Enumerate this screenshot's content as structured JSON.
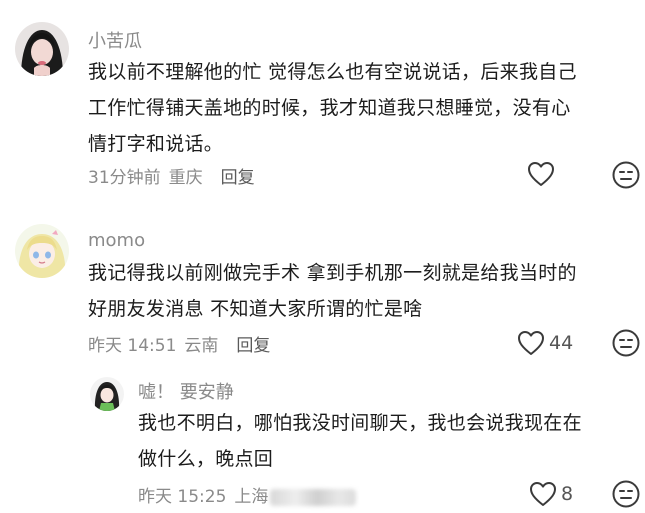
{
  "comments": [
    {
      "username": "小苦瓜",
      "lines": [
        "我以前不理解他的忙 觉得怎么也有空说说话，后来我自己",
        "工作忙得铺天盖地的时候，我才知道我只想睡觉，没有心",
        "情打字和说话。"
      ],
      "time": "31分钟前",
      "location": "重庆",
      "reply_label": "回复",
      "like_count": ""
    },
    {
      "username": "momo",
      "lines": [
        "我记得我以前刚做完手术 拿到手机那一刻就是给我当时的",
        "好朋友发消息 不知道大家所谓的忙是啥"
      ],
      "time": "昨天 14:51",
      "location": "云南",
      "reply_label": "回复",
      "like_count": "44"
    },
    {
      "username": "嘘！ 要安静",
      "lines": [
        "我也不明白，哪怕我没时间聊天，我也会说我现在在",
        "做什么，晚点回"
      ],
      "time": "昨天 15:25",
      "location": "上海",
      "like_count": "8"
    }
  ],
  "icons": {
    "like": "heart-outline-icon",
    "dislike": "meh-face-icon"
  },
  "colors": {
    "text": "#1c1c1c",
    "meta": "#8a8a8a",
    "icon": "#3a3a3a"
  }
}
